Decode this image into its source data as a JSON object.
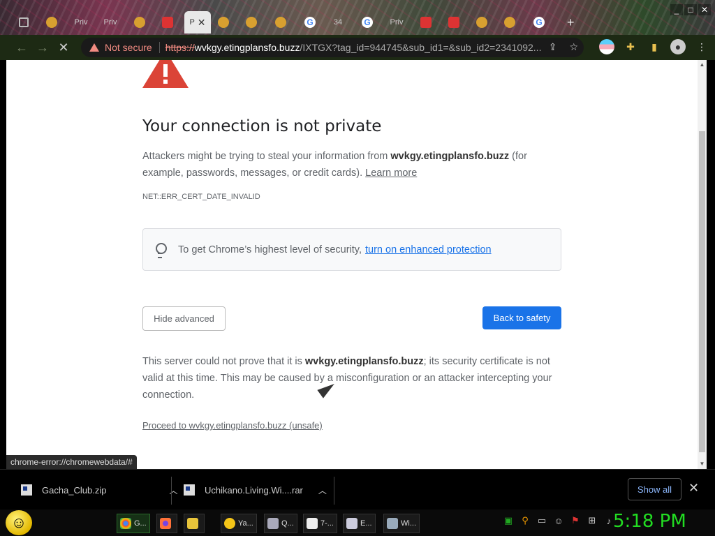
{
  "browser": {
    "active_tab_label": "P",
    "tab_labels": [
      "Priv",
      "Priv",
      "34",
      "Priv"
    ],
    "window_buttons": [
      "_",
      "□",
      "✕"
    ]
  },
  "toolbar": {
    "not_secure": "Not secure",
    "url_scheme": "https://",
    "url_host": "wvkgy.etingplansfo.buzz",
    "url_path": "/IXTGX?tag_id=944745&sub_id1=&sub_id2=2341092..."
  },
  "page": {
    "title": "Your connection is not private",
    "p1_a": "Attackers might be trying to steal your information from ",
    "p1_host": "wvkgy.etingplansfo.buzz",
    "p1_b": " (for example, passwords, messages, or credit cards). ",
    "learn_more": "Learn more",
    "error_code": "NET::ERR_CERT_DATE_INVALID",
    "enhanced_text": "To get Chrome’s highest level of security, ",
    "enhanced_link": "turn on enhanced protection",
    "hide_advanced": "Hide advanced",
    "back_to_safety": "Back to safety",
    "p2_a": "This server could not prove that it is ",
    "p2_host": "wvkgy.etingplansfo.buzz",
    "p2_b": "; its security certificate is not valid at this time. This may be caused by a misconfiguration or an attacker intercepting your connection.",
    "proceed": "Proceed to wvkgy.etingplansfo.buzz (unsafe)",
    "status_url": "chrome-error://chromewebdata/#"
  },
  "downloads": {
    "items": [
      {
        "name": "Gacha_Club.zip"
      },
      {
        "name": "Uchikano.Living.Wi....rar"
      }
    ],
    "show_all": "Show all",
    "close": "✕"
  },
  "taskbar": {
    "buttons": [
      {
        "label": "G..."
      },
      {
        "label": ""
      },
      {
        "label": ""
      },
      {
        "label": "Ya..."
      },
      {
        "label": "Q..."
      },
      {
        "label": "7-..."
      },
      {
        "label": "E..."
      },
      {
        "label": "Wi..."
      }
    ],
    "clock": "5:18 PM"
  },
  "colors": {
    "accent_blue": "#1a73e8",
    "error_red": "#db4437",
    "clock_green": "#22dd22"
  }
}
